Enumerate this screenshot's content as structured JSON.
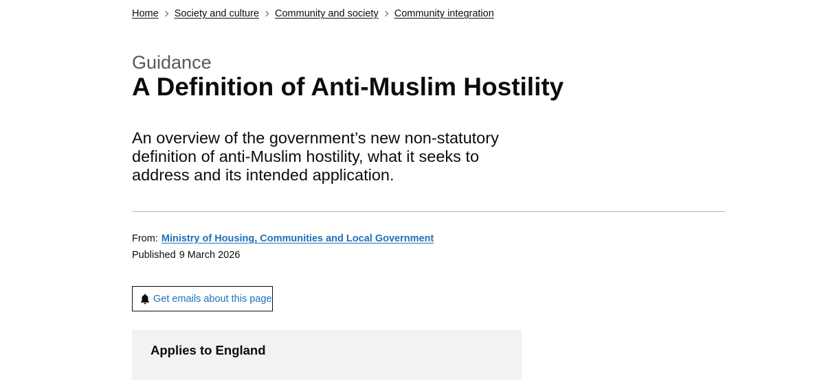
{
  "breadcrumb": {
    "items": [
      {
        "label": "Home"
      },
      {
        "label": "Society and culture"
      },
      {
        "label": "Community and society"
      },
      {
        "label": "Community integration"
      }
    ]
  },
  "header": {
    "caption": "Guidance",
    "title": "A Definition of Anti-Muslim Hostility"
  },
  "lead": "An overview of the government’s new non-statutory definition of anti-Muslim hostility, what it seeks to address and its intended application.",
  "metadata": {
    "from_label": "From:",
    "from_org": "Ministry of Housing, Communities and Local Government",
    "published_label": "Published",
    "published_date": "9 March 2026"
  },
  "email_button": {
    "icon": "bell-icon",
    "label": "Get emails about this page"
  },
  "applies": {
    "text": "Applies to England"
  },
  "colors": {
    "link": "#1d70b8",
    "text": "#0b0c0c",
    "secondary_text": "#505a5f",
    "panel_bg": "#f3f2f1"
  }
}
